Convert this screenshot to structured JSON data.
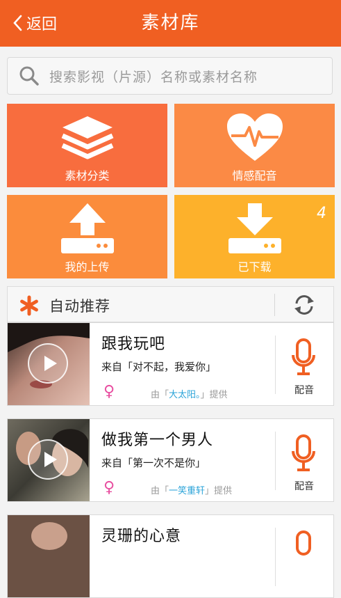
{
  "header": {
    "back_label": "返回",
    "title": "素材库"
  },
  "search": {
    "placeholder": "搜索影视（片源）名称或素材名称"
  },
  "tiles": [
    {
      "label": "素材分类",
      "icon": "layers-icon"
    },
    {
      "label": "情感配音",
      "icon": "heart-pulse-icon"
    },
    {
      "label": "我的上传",
      "icon": "upload-icon"
    },
    {
      "label": "已下载",
      "icon": "download-icon",
      "badge": "4"
    }
  ],
  "recommend": {
    "title": "自动推荐"
  },
  "items": [
    {
      "title": "跟我玩吧",
      "source": "来自「对不起，我爱你」",
      "provider_prefix": "由「",
      "provider_name": "大太阳。",
      "provider_suffix": "」提供",
      "dub_label": "配音"
    },
    {
      "title": "做我第一个男人",
      "source": "来自「第一次不是你」",
      "provider_prefix": "由「",
      "provider_name": "一笑重轩",
      "provider_suffix": "」提供",
      "dub_label": "配音"
    },
    {
      "title": "灵珊的心意",
      "source": "",
      "provider_prefix": "",
      "provider_name": "",
      "provider_suffix": "",
      "dub_label": ""
    }
  ],
  "colors": {
    "topbar": "#f05f22",
    "accent": "#f05f22",
    "female": "#e84ea0",
    "link": "#2aa3d8"
  }
}
